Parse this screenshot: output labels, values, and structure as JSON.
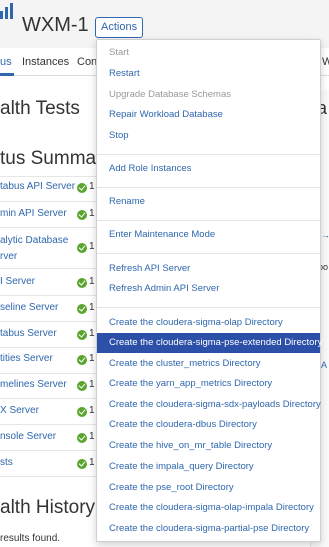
{
  "colors": {
    "accent": "#2f67ad",
    "selected_bg": "#2c4fa8",
    "ok_green": "#5aa52e",
    "disabled": "#999999"
  },
  "header": {
    "logo_icon": "cluster-bars-icon",
    "title": "WXM-1",
    "actions_label": "Actions"
  },
  "tabs": [
    {
      "label": "us"
    },
    {
      "label": "Instances"
    },
    {
      "label": "Conf"
    },
    {
      "label": "W"
    }
  ],
  "sections": {
    "health_tests": "alth Tests",
    "status_summary": "tus Summary",
    "health_history": "alth History"
  },
  "status_summary": [
    {
      "label": "tabus API Server",
      "count": "1"
    },
    {
      "label": "min API Server",
      "count": "1"
    },
    {
      "label": "alytic Database",
      "label2": "rver",
      "count": "1"
    },
    {
      "label": "I Server",
      "count": "1"
    },
    {
      "label": "seline Server",
      "count": "1"
    },
    {
      "label": "tabus Server",
      "count": "1"
    },
    {
      "label": "tities Server",
      "count": "1"
    },
    {
      "label": "melines Server",
      "count": "1"
    },
    {
      "label": "X Server",
      "count": "1"
    },
    {
      "label": "nsole Server",
      "count": "1"
    },
    {
      "label": "sts",
      "count": "1"
    }
  ],
  "history": {
    "no_results": "results found."
  },
  "right_panel": {
    "char1": "a",
    "link1": "→",
    "text2": "po",
    "link2": "A"
  },
  "menu": {
    "items": [
      {
        "label": "Start",
        "disabled": true
      },
      {
        "label": "Restart"
      },
      {
        "label": "Upgrade Database Schemas",
        "disabled": true
      },
      {
        "label": "Repair Workload Database"
      },
      {
        "label": "Stop"
      },
      {
        "label": "Add Role Instances"
      },
      {
        "label": "Rename"
      },
      {
        "label": "Enter Maintenance Mode"
      },
      {
        "label": "Refresh API Server"
      },
      {
        "label": "Refresh Admin API Server"
      },
      {
        "label": "Create the cloudera-sigma-olap Directory"
      },
      {
        "label": "Create the cloudera-sigma-pse-extended Directory",
        "selected": true
      },
      {
        "label": "Create the cluster_metrics Directory"
      },
      {
        "label": "Create the yarn_app_metrics Directory"
      },
      {
        "label": "Create the cloudera-sigma-sdx-payloads Directory"
      },
      {
        "label": "Create the cloudera-dbus Directory"
      },
      {
        "label": "Create the hive_on_mr_table Directory"
      },
      {
        "label": "Create the impala_query Directory"
      },
      {
        "label": "Create the pse_root Directory"
      },
      {
        "label": "Create the cloudera-sigma-olap-impala Directory"
      },
      {
        "label": "Create the cloudera-sigma-partial-pse Directory"
      }
    ]
  }
}
